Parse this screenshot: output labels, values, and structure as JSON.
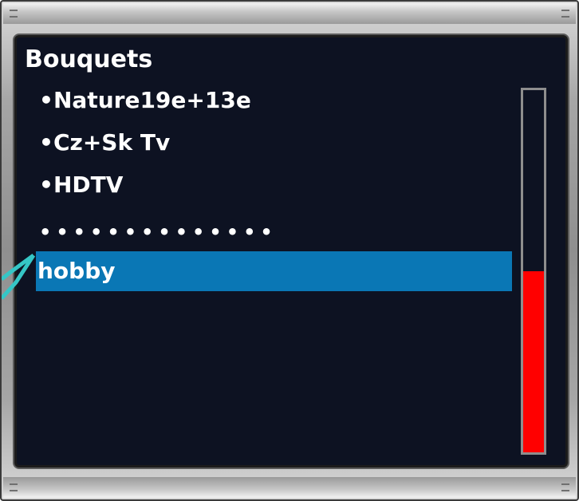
{
  "panel": {
    "title": "Bouquets",
    "bullet": "•",
    "items": [
      {
        "label": "Nature19e+13e"
      },
      {
        "label": "Cz+Sk Tv"
      },
      {
        "label": "HDTV"
      }
    ],
    "separator": "••••••••••••••",
    "selected_item": "hobby"
  },
  "scrollbar": {
    "position_fraction": 0.5
  },
  "colors": {
    "background": "#0d1222",
    "highlight": "#0a77b5",
    "scroll_indicator": "#ff0000",
    "callout": "#35c6c6"
  }
}
